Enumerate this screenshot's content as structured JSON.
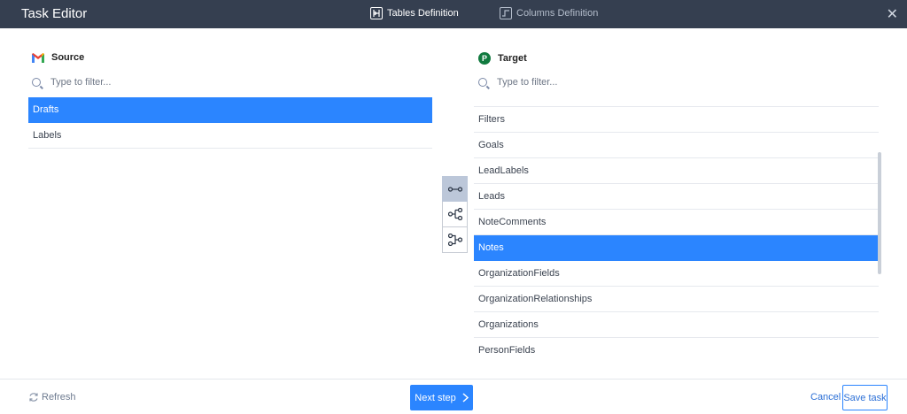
{
  "header": {
    "title": "Task Editor",
    "steps": [
      {
        "label": "Tables Definition",
        "icon": "tables-definition-icon",
        "active": true
      },
      {
        "label": "Columns Definition",
        "icon": "columns-definition-icon",
        "active": false
      }
    ],
    "close_icon": "close-icon"
  },
  "source": {
    "title": "Source",
    "logo": "gmail-logo",
    "filter_placeholder": "Type to filter...",
    "items": [
      "Drafts",
      "Labels"
    ],
    "selected": "Drafts"
  },
  "target": {
    "title": "Target",
    "logo": "pipedrive-logo",
    "logo_letter": "P",
    "filter_placeholder": "Type to filter...",
    "items": [
      "Filters",
      "Goals",
      "LeadLabels",
      "Leads",
      "NoteComments",
      "Notes",
      "OrganizationFields",
      "OrganizationRelationships",
      "Organizations",
      "PersonFields"
    ],
    "selected": "Notes"
  },
  "mapping_buttons": [
    {
      "icon": "one-to-one-map-icon",
      "active": true
    },
    {
      "icon": "one-to-many-map-icon",
      "active": false
    },
    {
      "icon": "many-to-one-map-icon",
      "active": false
    }
  ],
  "footer": {
    "refresh_label": "Refresh",
    "next_label": "Next step",
    "cancel_label": "Cancel",
    "save_label": "Save task"
  },
  "colors": {
    "header_bg": "#353f50",
    "accent": "#2b85ff",
    "pipedrive_green": "#117a3f"
  }
}
